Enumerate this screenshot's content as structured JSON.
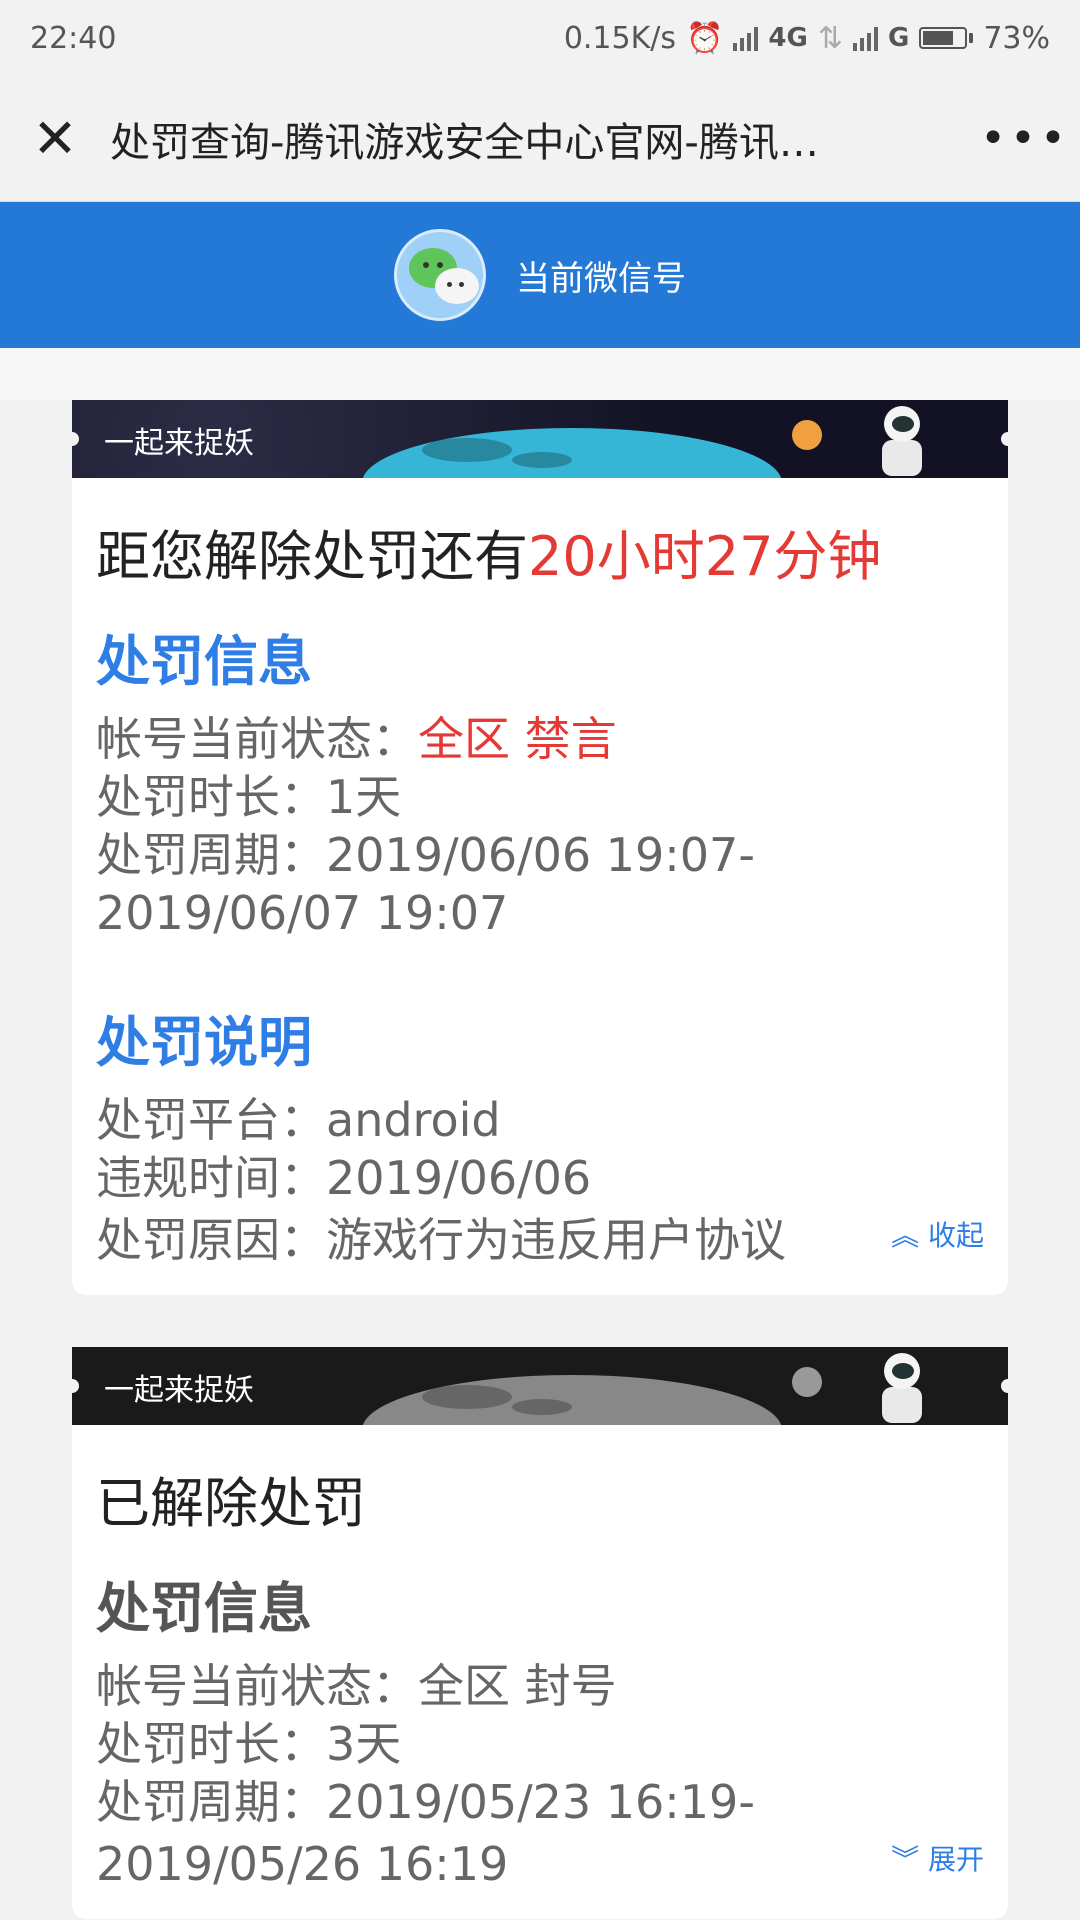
{
  "status_bar": {
    "time": "22:40",
    "speed": "0.15K/s",
    "alarm_icon": "alarm-icon",
    "net1": "4G",
    "net2": "G",
    "battery": "73%",
    "battery_level": 0.73
  },
  "nav": {
    "close_icon": "close-icon",
    "title": "处罚查询-腾讯游戏安全中心官网-腾讯…",
    "more_icon": "more-icon"
  },
  "account": {
    "label": "当前微信号",
    "avatar_icon": "wechat-icon"
  },
  "cards": [
    {
      "banner_label": "一起来捉妖",
      "headline_prefix": "距您解除处罚还有",
      "headline_highlight": "20小时27分钟",
      "info_title": "处罚信息",
      "status_key": "帐号当前状态：",
      "status_value": "全区 禁言",
      "duration_key": "处罚时长：",
      "duration_value": "1天",
      "period_key": "处罚周期：",
      "period_value_line1": "2019/06/06 19:07-",
      "period_value_line2": "2019/06/07 19:07",
      "detail_title": "处罚说明",
      "platform_key": "处罚平台：",
      "platform_value": "android",
      "time_key": "违规时间：",
      "time_value": "2019/06/06",
      "reason_key": "处罚原因：",
      "reason_value": "游戏行为违反用户协议",
      "toggle_label": "收起"
    },
    {
      "banner_label": "一起来捉妖",
      "headline": "已解除处罚",
      "info_title": "处罚信息",
      "status_key": "帐号当前状态：",
      "status_value": "全区 封号",
      "duration_key": "处罚时长：",
      "duration_value": "3天",
      "period_key": "处罚周期：",
      "period_value_line1": "2019/05/23 16:19-",
      "period_value_line2": "2019/05/26 16:19",
      "toggle_label": "展开"
    }
  ],
  "colors": {
    "header_blue": "#2478d6",
    "accent_blue": "#2e7ee6",
    "alert_red": "#e53935"
  }
}
